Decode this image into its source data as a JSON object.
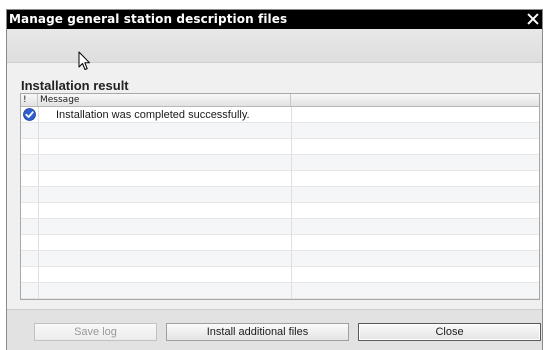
{
  "dialog": {
    "title": "Manage general station description files"
  },
  "section": {
    "title": "Installation result"
  },
  "grid": {
    "columns": [
      "!",
      "Message",
      ""
    ],
    "rows": [
      {
        "status": "success-check-icon",
        "message": "Installation was completed successfully."
      }
    ]
  },
  "footer": {
    "save_log_label": "Save log",
    "install_label": "Install additional files",
    "close_label": "Close"
  },
  "colors": {
    "titlebar": "#000000",
    "success_icon": "#2f5fcf"
  }
}
